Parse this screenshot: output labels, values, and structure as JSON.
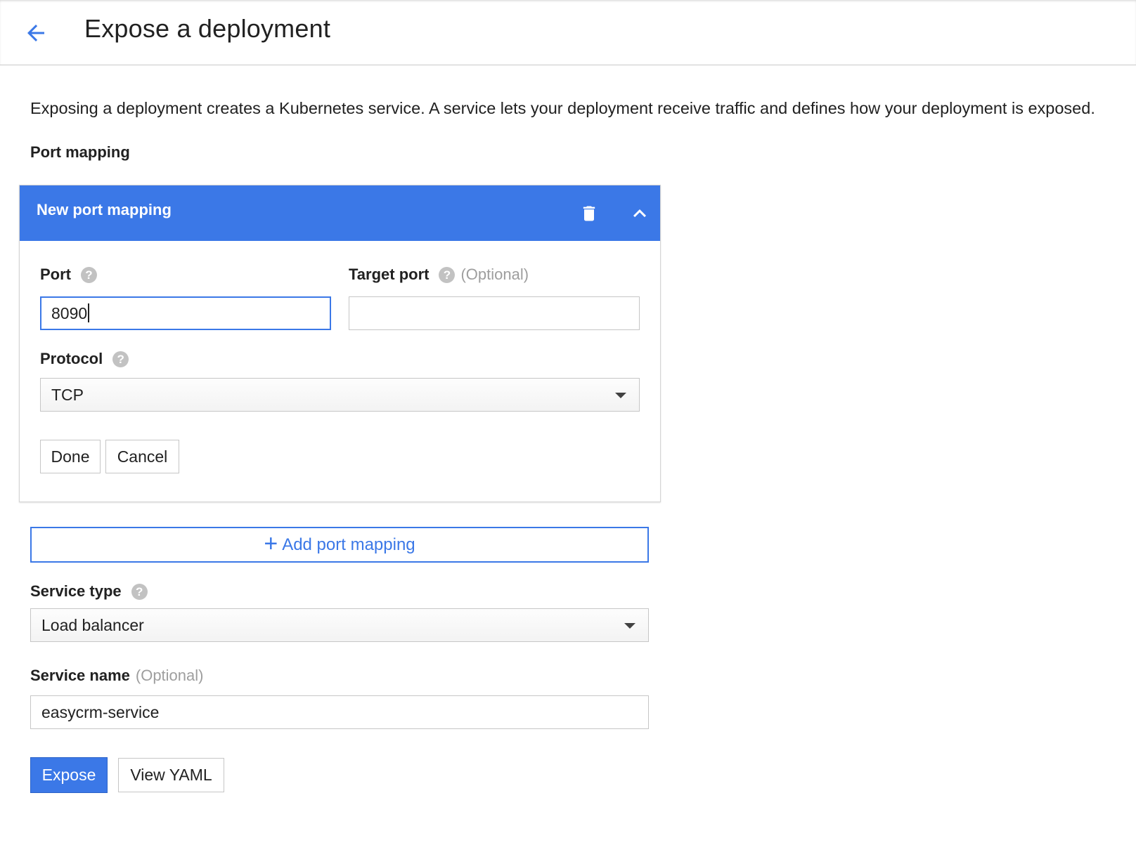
{
  "header": {
    "back_icon": "arrow-left-icon",
    "title": "Expose a deployment"
  },
  "intro_text": "Exposing a deployment creates a Kubernetes service. A service lets your deployment receive traffic and defines how your deployment is exposed.",
  "port_mapping": {
    "section_label": "Port mapping",
    "panel": {
      "title": "New port mapping",
      "delete_icon": "trash-icon",
      "collapse_icon": "chevron-up-icon",
      "port": {
        "label": "Port",
        "value": "8090"
      },
      "target_port": {
        "label": "Target port",
        "optional": "(Optional)",
        "value": ""
      },
      "protocol": {
        "label": "Protocol",
        "selected": "TCP"
      },
      "done_label": "Done",
      "cancel_label": "Cancel"
    },
    "add_label": "Add port mapping"
  },
  "service_type": {
    "label": "Service type",
    "selected": "Load balancer"
  },
  "service_name": {
    "label": "Service name",
    "optional": "(Optional)",
    "value": "easycrm-service"
  },
  "actions": {
    "expose_label": "Expose",
    "yaml_label": "View YAML"
  },
  "help_glyph": "?",
  "colors": {
    "accent": "#3b78e7",
    "help_icon": "#c2c2c2",
    "optional_text": "#9e9e9e"
  }
}
